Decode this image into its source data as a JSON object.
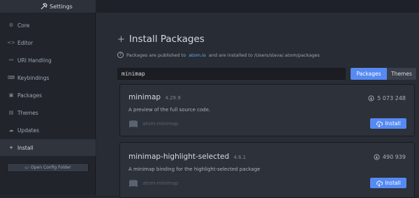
{
  "tab": {
    "title": "Settings",
    "icon": "tools-icon"
  },
  "sidebar": {
    "items": [
      {
        "label": "Core",
        "icon": "settings-icon"
      },
      {
        "label": "Editor",
        "icon": "code-icon"
      },
      {
        "label": "URI Handling",
        "icon": "link-icon"
      },
      {
        "label": "Keybindings",
        "icon": "keyboard-icon"
      },
      {
        "label": "Packages",
        "icon": "package-icon"
      },
      {
        "label": "Themes",
        "icon": "paintcan-icon"
      },
      {
        "label": "Updates",
        "icon": "cloud-download-icon"
      },
      {
        "label": "Install",
        "icon": "plus-icon"
      }
    ],
    "active": "Install",
    "config_button": "Open Config Folder"
  },
  "main": {
    "title": "Install Packages",
    "info_prefix": "Packages are published to",
    "info_link": "atom.io",
    "info_suffix": "and are installed to /Users/slava/.atom/packages",
    "search_value": "minimap",
    "toggle": {
      "packages": "Packages",
      "themes": "Themes",
      "active": "Packages"
    },
    "packages": [
      {
        "name": "minimap",
        "version": "4.29.9",
        "description": "A preview of the full source code.",
        "owner": "atom-minimap",
        "downloads": "5 073 248",
        "install_label": "Install"
      },
      {
        "name": "minimap-highlight-selected",
        "version": "4.6.1",
        "description": "A minimap binding for the highlight-selected package",
        "owner": "atom-minimap",
        "downloads": "490 939",
        "install_label": "Install"
      }
    ]
  },
  "colors": {
    "accent": "#568af2",
    "link": "#61afef",
    "sidebar_bg": "#21252b",
    "main_bg": "#282c34"
  }
}
